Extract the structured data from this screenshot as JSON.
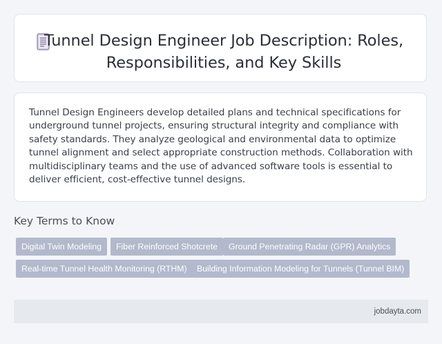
{
  "header": {
    "title": "Tunnel Design Engineer Job Description: Roles, Responsibilities, and Key Skills",
    "icon": "document-icon"
  },
  "description": {
    "text": "Tunnel Design Engineers develop detailed plans and technical specifications for underground tunnel projects, ensuring structural integrity and compliance with safety standards. They analyze geological and environmental data to optimize tunnel alignment and select appropriate construction methods. Collaboration with multidisciplinary teams and the use of advanced software tools is essential to deliver efficient, cost-effective tunnel designs."
  },
  "key_terms": {
    "heading": "Key Terms to Know",
    "tags": [
      "Digital Twin Modeling",
      "Fiber Reinforced Shotcrete",
      "Ground Penetrating Radar (GPR) Analytics",
      "Real-time Tunnel Health Monitoring (RTHM)",
      "Building Information Modeling for Tunnels (Tunnel BIM)"
    ]
  },
  "footer": {
    "site": "jobdayta.com"
  },
  "colors": {
    "background": "#f3f5f8",
    "card": "#ffffff",
    "tag": "#b3b9cc",
    "footer": "#e6eaee"
  }
}
